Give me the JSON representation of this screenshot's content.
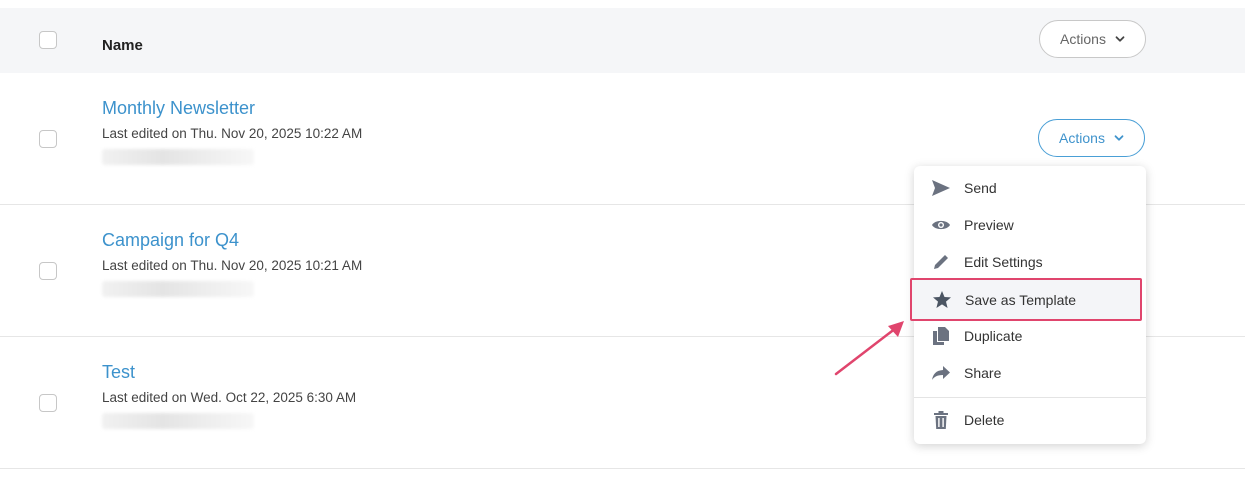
{
  "header": {
    "name_label": "Name",
    "actions_label": "Actions"
  },
  "rows": [
    {
      "title": "Monthly Newsletter",
      "meta": "Last edited on Thu. Nov 20, 2025 10:22 AM",
      "actions_label": "Actions",
      "actions_active": true
    },
    {
      "title": "Campaign for Q4",
      "meta": "Last edited on Thu. Nov 20, 2025 10:21 AM"
    },
    {
      "title": "Test",
      "meta": "Last edited on Wed. Oct 22, 2025 6:30 AM"
    }
  ],
  "dropdown": {
    "items": [
      {
        "label": "Send",
        "icon": "send-icon"
      },
      {
        "label": "Preview",
        "icon": "eye-icon"
      },
      {
        "label": "Edit Settings",
        "icon": "pencil-icon"
      },
      {
        "label": "Save as Template",
        "icon": "star-icon",
        "highlighted": true
      },
      {
        "label": "Duplicate",
        "icon": "duplicate-icon"
      },
      {
        "label": "Share",
        "icon": "share-icon"
      },
      {
        "label": "Delete",
        "icon": "trash-icon"
      }
    ]
  },
  "colors": {
    "link": "#3c92cc",
    "accent_border": "#4a9fd6",
    "highlight_border": "#e0456d",
    "icon": "#6b7280"
  }
}
